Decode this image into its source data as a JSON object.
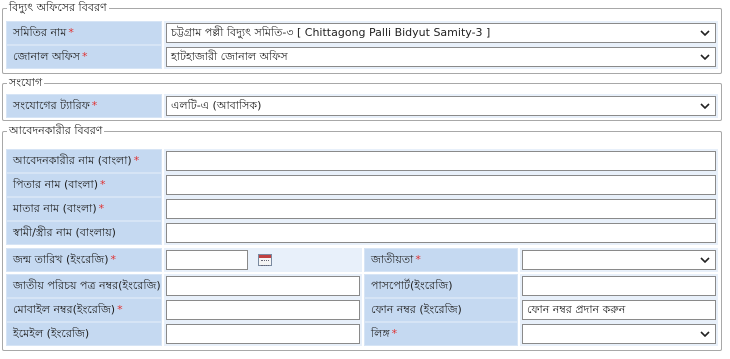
{
  "sections": {
    "office": "বিদ্যুৎ অফিসের বিবরণ",
    "connection": "সংযোগ",
    "applicant": "আবেদনকারীর বিবরণ"
  },
  "office": {
    "samity_label": "সমিতির নাম",
    "samity_value": "চট্টগ্রাম পল্লী বিদ্যুৎ সমিতি-৩ [ Chittagong Palli Bidyut Samity-3 ]",
    "zonal_label": "জোনাল অফিস",
    "zonal_value": "হাটহাজারী জোনাল অফিস"
  },
  "connection": {
    "tariff_label": "সংযোগের ট্যারিফ",
    "tariff_value": "এলটি-এ (আবাসিক)"
  },
  "applicant": {
    "name_label": "আবেদনকারীর নাম (বাংলা)",
    "father_label": "পিতার নাম (বাংলা)",
    "mother_label": "মাতার নাম (বাংলা)",
    "spouse_label": "স্বামী/স্ত্রীর নাম (বাংলায়)",
    "dob_label": "জন্ম তারিখ (ইংরেজি)",
    "nationality_label": "জাতীয়তা",
    "nid_label": "জাতীয় পরিচয় পত্র নম্বর(ইংরেজি)",
    "passport_label": "পাসপোর্ট(ইংরেজি)",
    "mobile_label": "মোবাইল নম্বর(ইংরেজি)",
    "phone_label": "ফোন নম্বর (ইংরেজি)",
    "phone_placeholder": "ফোন নম্বর প্রদান করুন",
    "email_label": "ইমেইল (ইংরেজি)",
    "gender_label": "লিঙ্গ"
  },
  "required_mark": "*",
  "icons": {
    "dropdown": "chevron-down-icon",
    "calendar": "calendar-icon"
  },
  "colors": {
    "label_bg": "#c5d9f1",
    "value_bg": "#e8f0fa",
    "required": "#e03030"
  }
}
